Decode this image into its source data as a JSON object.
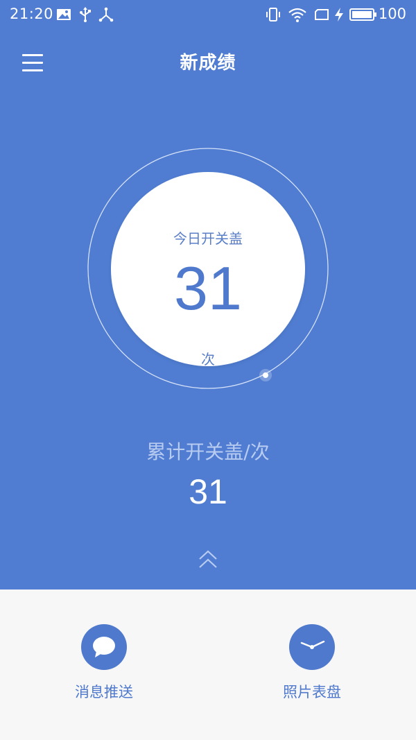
{
  "status_bar": {
    "time": "21:20",
    "battery_level": "100",
    "left_icons": [
      "image-icon",
      "usb-icon",
      "share-icon"
    ],
    "right_icons": [
      "vibrate-icon",
      "wifi-icon",
      "sim-icon",
      "charging-icon",
      "battery-icon"
    ]
  },
  "header": {
    "title": "新成绩",
    "menu_icon": "hamburger-menu-icon"
  },
  "gauge": {
    "label": "今日开关盖",
    "value": "31",
    "unit": "次"
  },
  "cumulative": {
    "label": "累计开关盖/次",
    "value": "31",
    "expand_icon": "double-chevron-up-icon"
  },
  "actions": [
    {
      "label": "消息推送",
      "icon": "chat-bubble-icon"
    },
    {
      "label": "照片表盘",
      "icon": "clock-icon"
    }
  ],
  "colors": {
    "primary": "#507dd2",
    "panel_background": "#f7f7f7",
    "accent": "#4f79cc"
  }
}
